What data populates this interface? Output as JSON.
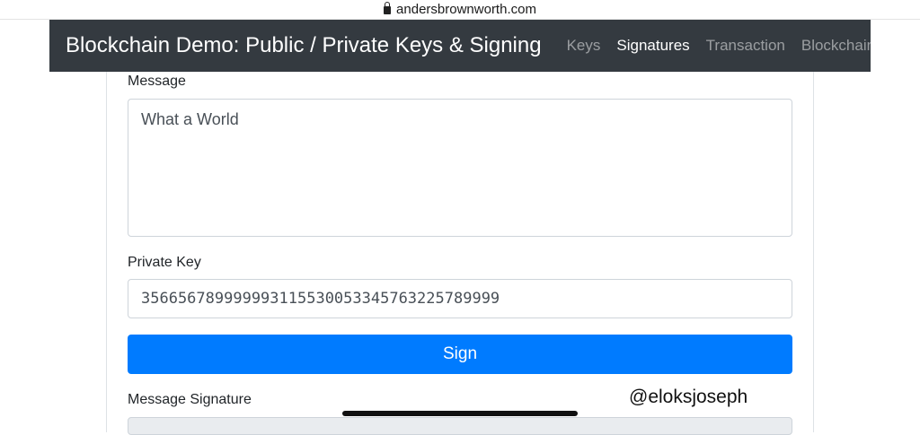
{
  "browser": {
    "url": "andersbrownworth.com"
  },
  "navbar": {
    "brand": "Blockchain Demo: Public / Private Keys & Signing",
    "links": [
      {
        "label": "Keys",
        "active": false
      },
      {
        "label": "Signatures",
        "active": true
      },
      {
        "label": "Transaction",
        "active": false
      },
      {
        "label": "Blockchain",
        "active": false
      }
    ]
  },
  "form": {
    "message_label": "Message",
    "message_value": "What a World",
    "private_key_label": "Private Key",
    "private_key_value": "35665678999999311553005334576322578999​9",
    "sign_button": "Sign",
    "signature_label": "Message Signature"
  },
  "watermark": "@eloksjoseph",
  "colors": {
    "navbar_bg": "#343a40",
    "primary": "#007bff"
  }
}
